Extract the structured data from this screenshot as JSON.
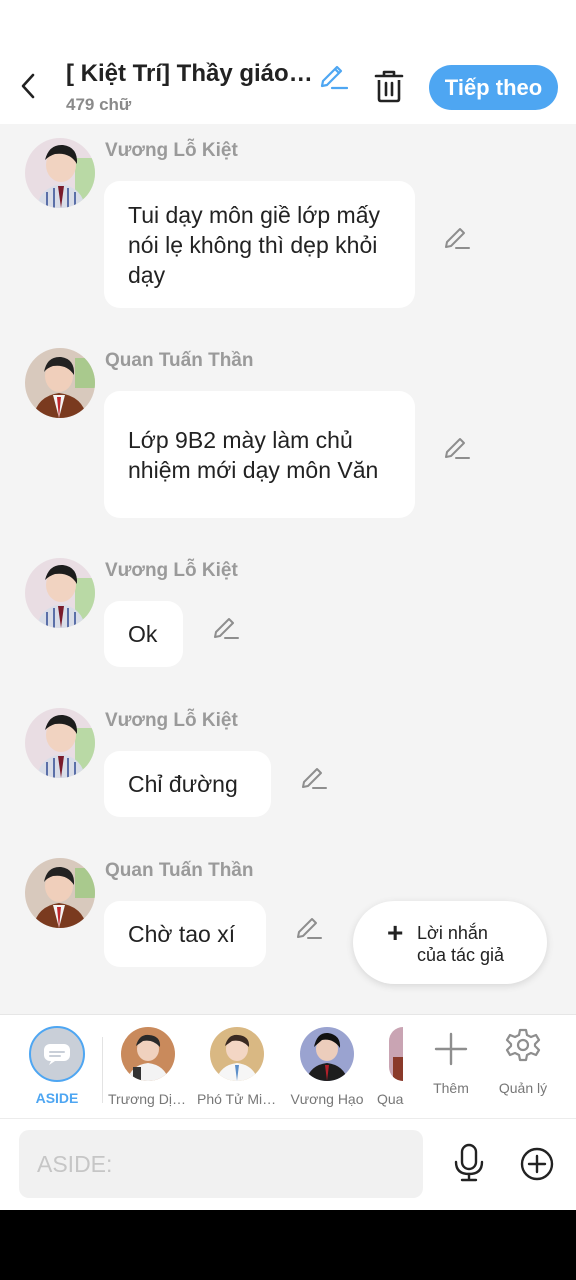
{
  "header": {
    "title": "[ Kiệt Trí] Thầy giáo mới",
    "word_count": "479 chữ",
    "next_label": "Tiếp theo",
    "icons": [
      "back-arrow-icon",
      "edit-pencil-icon",
      "trash-icon"
    ]
  },
  "messages": [
    {
      "sender": "Vương Lỗ Kiệt",
      "text": "Tui dạy môn giề lớp mấy nói lẹ không thì dẹp khỏi dạy"
    },
    {
      "sender": "Quan Tuấn Thần",
      "text": "Lớp 9B2 mày làm chủ nhiệm mới dạy môn Văn"
    },
    {
      "sender": "Vương Lỗ Kiệt",
      "text": "Ok"
    },
    {
      "sender": "Vương Lỗ Kiệt",
      "text": "Chỉ đường"
    },
    {
      "sender": "Quan Tuấn Thần",
      "text": "Chờ tao xí"
    }
  ],
  "author_note": {
    "plus": "+",
    "line1": "Lời nhắn",
    "line2": "của tác giả"
  },
  "characters": {
    "aside_label": "ASIDE",
    "list": [
      {
        "name": "Trương Dịch Nhiên"
      },
      {
        "name": "Phó Tử Minh"
      },
      {
        "name": "Vương Hạo"
      },
      {
        "name": "Quan Tuấn Thần"
      }
    ],
    "add_label": "Thêm",
    "manage_label": "Quản lý"
  },
  "input": {
    "placeholder": "ASIDE:"
  },
  "colors": {
    "accent": "#4ea6f2",
    "bubble": "#ffffff",
    "background": "#f4f4f4"
  }
}
